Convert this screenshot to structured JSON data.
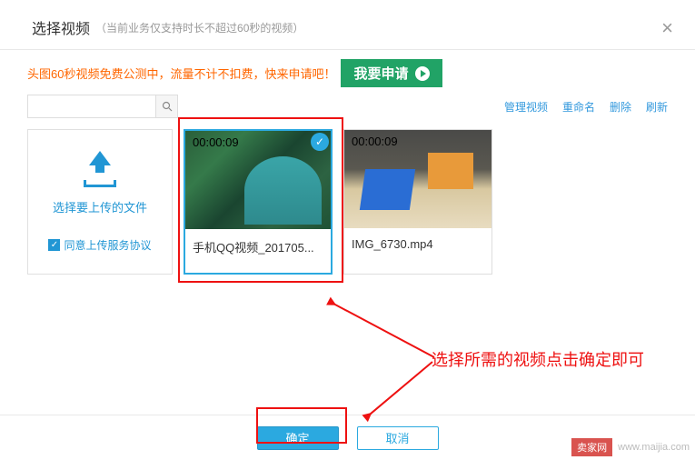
{
  "header": {
    "title": "选择视频",
    "subtitle": "（当前业务仅支持时长不超过60秒的视频）",
    "close_label": "×"
  },
  "notice": {
    "text": "头图60秒视频免费公测中，流量不计不扣费，快来申请吧！",
    "apply_label": "我要申请"
  },
  "toolbar": {
    "search_placeholder": "",
    "links": {
      "manage": "管理视频",
      "rename": "重命名",
      "delete": "删除",
      "refresh": "刷新"
    }
  },
  "upload": {
    "label": "选择要上传的文件",
    "agreement": "同意上传服务协议",
    "checked": true
  },
  "videos": [
    {
      "duration": "00:00:09",
      "name": "手机QQ视频_201705...",
      "selected": true
    },
    {
      "duration": "00:00:09",
      "name": "IMG_6730.mp4",
      "selected": false
    }
  ],
  "annotation": {
    "text": "选择所需的视频点击确定即可"
  },
  "footer": {
    "ok": "确定",
    "cancel": "取消"
  },
  "watermark": {
    "badge": "卖家网",
    "url": "www.maijia.com"
  }
}
